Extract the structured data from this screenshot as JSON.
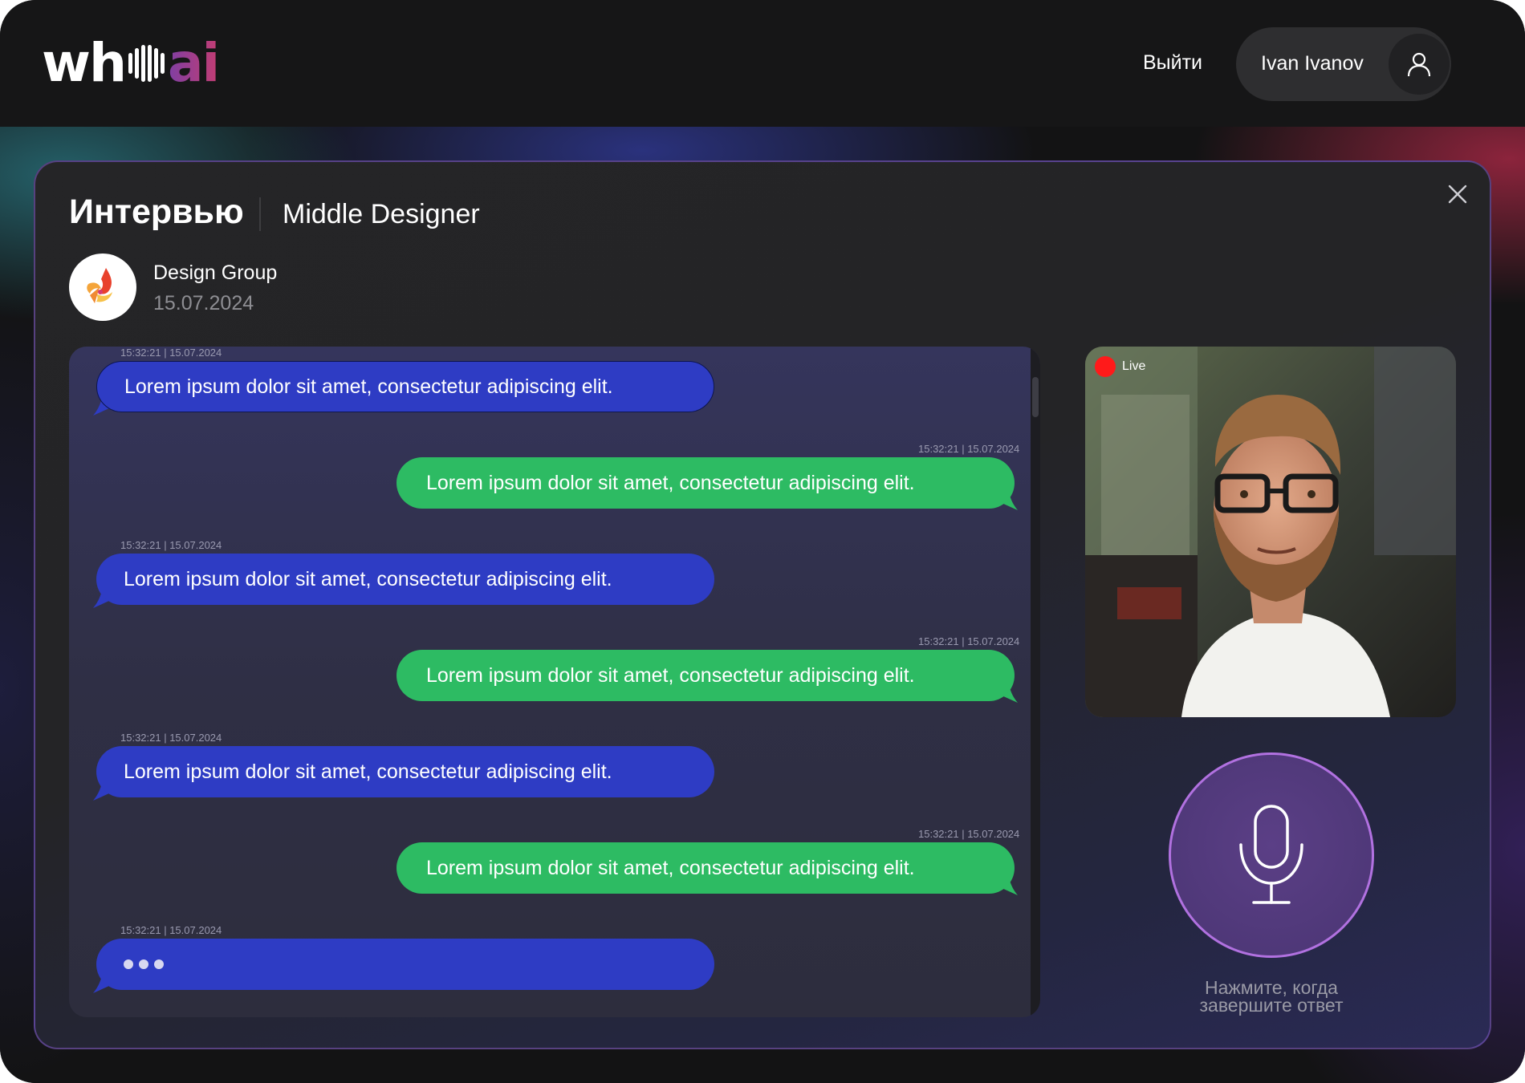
{
  "app": {
    "logo_text_left": "wh",
    "logo_text_right": "ai",
    "brand_colors": [
      "#ffffff",
      "#7f3fa3",
      "#c23d73"
    ]
  },
  "header": {
    "logout_label": "Выйти",
    "user_name": "Ivan Ivanov",
    "user_icon": "user-icon"
  },
  "interview": {
    "title": "Интервью",
    "position": "Middle Designer",
    "company_name": "Design Group",
    "date": "15.07.2024",
    "close_icon": "close-icon"
  },
  "chat": {
    "messages": [
      {
        "side": "interviewer",
        "timestamp": "15:32:21 | 15.07.2024",
        "text": "Lorem ipsum dolor sit amet, consectetur adipiscing elit."
      },
      {
        "side": "candidate",
        "timestamp": "15:32:21 | 15.07.2024",
        "text": "Lorem ipsum dolor sit amet, consectetur adipiscing elit."
      },
      {
        "side": "interviewer",
        "timestamp": "15:32:21 | 15.07.2024",
        "text": "Lorem ipsum dolor sit amet, consectetur adipiscing elit."
      },
      {
        "side": "candidate",
        "timestamp": "15:32:21 | 15.07.2024",
        "text": "Lorem ipsum dolor sit amet, consectetur adipiscing elit."
      },
      {
        "side": "interviewer",
        "timestamp": "15:32:21 | 15.07.2024",
        "text": "Lorem ipsum dolor sit amet, consectetur adipiscing elit."
      },
      {
        "side": "candidate",
        "timestamp": "15:32:21 | 15.07.2024",
        "text": "Lorem ipsum dolor sit amet, consectetur adipiscing elit."
      },
      {
        "side": "interviewer",
        "timestamp": "15:32:21 | 15.07.2024",
        "typing": true
      }
    ],
    "colors": {
      "interviewer": "#2e3cc4",
      "candidate": "#2dbb63"
    }
  },
  "video": {
    "live_label": "Live",
    "live_color": "#ff1a1a"
  },
  "microphone": {
    "icon": "microphone-icon",
    "hint_line1": "Нажмите, когда",
    "hint_line2": "завершите ответ",
    "accent_color": "#b171e0"
  }
}
